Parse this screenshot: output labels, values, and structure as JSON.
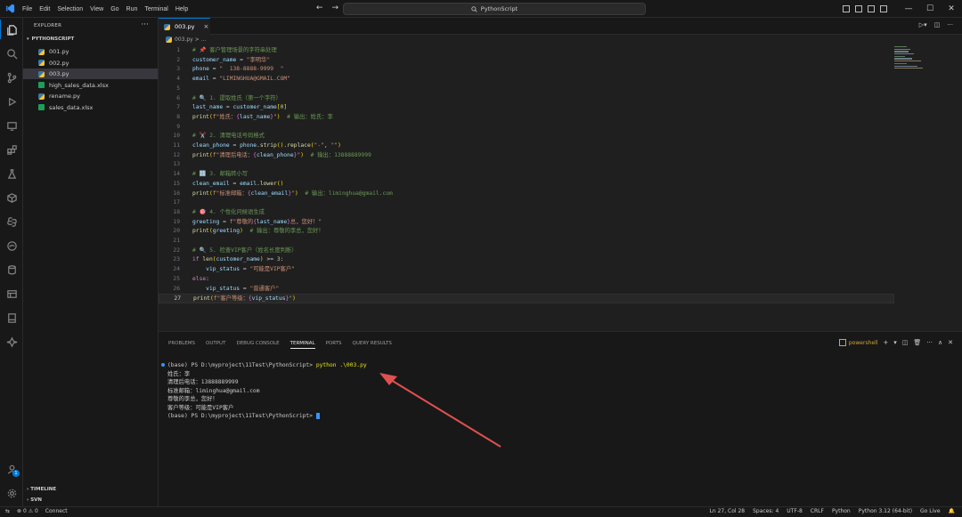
{
  "menu": [
    "File",
    "Edit",
    "Selection",
    "View",
    "Go",
    "Run",
    "Terminal",
    "Help"
  ],
  "search": {
    "text": "PythonScript"
  },
  "window": {
    "minimize": "—",
    "maximize": "☐",
    "close": "✕"
  },
  "explorer": {
    "title": "EXPLORER",
    "more": "···",
    "folder": "PYTHONSCRIPT",
    "files": [
      {
        "name": "001.py"
      },
      {
        "name": "002.py"
      },
      {
        "name": "003.py"
      },
      {
        "name": "high_sales_data.xlsx"
      },
      {
        "name": "rename.py"
      },
      {
        "name": "sales_data.xlsx"
      }
    ],
    "timeline": "TIMELINE",
    "svn": "SVN"
  },
  "editor": {
    "tab": "003.py",
    "breadcrumb": "003.py > ...",
    "current_line": 27,
    "lines": [
      {
        "n": "1",
        "t": "# 📌 客户管理场景的字符串处理"
      },
      {
        "n": "2",
        "t": "customer_name = \"李明华\""
      },
      {
        "n": "3",
        "t": "phone = \"  138-8888-9999  \""
      },
      {
        "n": "4",
        "t": "email = \"LIMINGHUA@GMAIL.COM\""
      },
      {
        "n": "5",
        "t": ""
      },
      {
        "n": "6",
        "t": "# 🔍 1. 提取姓氏（第一个字符）"
      },
      {
        "n": "7",
        "t": "last_name = customer_name[0]"
      },
      {
        "n": "8",
        "t": "print(f\"姓氏：{last_name}\")  # 输出：姓氏：李"
      },
      {
        "n": "9",
        "t": ""
      },
      {
        "n": "10",
        "t": "# ✂️ 2. 清理电话号码格式"
      },
      {
        "n": "11",
        "t": "clean_phone = phone.strip().replace(\"-\", \"\")"
      },
      {
        "n": "12",
        "t": "print(f\"清理后电话：{clean_phone}\")  # 输出：13888889999"
      },
      {
        "n": "13",
        "t": ""
      },
      {
        "n": "14",
        "t": "# 🔡 3. 邮箱转小写"
      },
      {
        "n": "15",
        "t": "clean_email = email.lower()"
      },
      {
        "n": "16",
        "t": "print(f\"标准邮箱：{clean_email}\")  # 输出：liminghua@gmail.com"
      },
      {
        "n": "17",
        "t": ""
      },
      {
        "n": "18",
        "t": "# 🎯 4. 个性化问候语生成"
      },
      {
        "n": "19",
        "t": "greeting = f\"尊敬的{last_name}总，您好！\""
      },
      {
        "n": "20",
        "t": "print(greeting)  # 输出：尊敬的李总，您好！"
      },
      {
        "n": "21",
        "t": ""
      },
      {
        "n": "22",
        "t": "# 🔍 5. 检查VIP客户（姓名长度判断）"
      },
      {
        "n": "23",
        "t": "if len(customer_name) >= 3:"
      },
      {
        "n": "24",
        "t": "    vip_status = \"可能是VIP客户\""
      },
      {
        "n": "25",
        "t": "else:"
      },
      {
        "n": "26",
        "t": "    vip_status = \"普通客户\""
      },
      {
        "n": "27",
        "t": "print(f\"客户等级：{vip_status}\")"
      }
    ]
  },
  "panel": {
    "tabs": [
      "PROBLEMS",
      "OUTPUT",
      "DEBUG CONSOLE",
      "TERMINAL",
      "PORTS",
      "QUERY RESULTS"
    ],
    "active_tab": "TERMINAL",
    "shell": "powershell",
    "terminal": {
      "prompt1": "(base) PS D:\\myproject\\11Test\\PythonScript> ",
      "command": "python .\\003.py",
      "output": [
        "姓氏：李",
        "清理后电话：13888889999",
        "标准邮箱：liminghua@gmail.com",
        "尊敬的李总，您好！",
        "客户等级：可能是VIP客户"
      ],
      "prompt2": "(base) PS D:\\myproject\\11Test\\PythonScript> "
    }
  },
  "status": {
    "problems": "⊗ 0 ⚠ 0",
    "connect": "Connect",
    "position": "Ln 27, Col 28",
    "spaces": "Spaces: 4",
    "encoding": "UTF-8",
    "eol": "CRLF",
    "language": "Python",
    "interpreter": "Python 3.12 (64-bit)",
    "golive": "Go Live"
  },
  "colors": {
    "accent": "#0078d4",
    "arrow": "#e05050",
    "terminal_command": "#e5e510"
  }
}
